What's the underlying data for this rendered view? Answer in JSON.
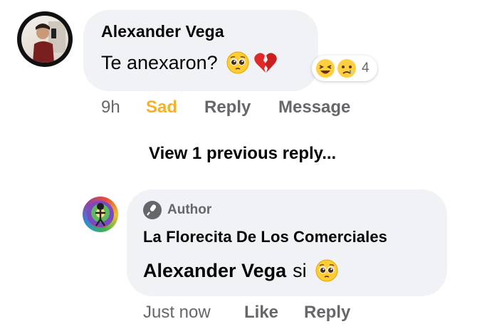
{
  "comment": {
    "author": "Alexander Vega",
    "text": "Te anexaron?",
    "emojis": [
      "pleading-face",
      "broken-heart"
    ],
    "reactions": {
      "icons": [
        "laughing-face",
        "crying-face"
      ],
      "count": "4"
    },
    "actions": {
      "time": "9h",
      "reaction_label": "Sad",
      "reply": "Reply",
      "message": "Message"
    }
  },
  "view_previous": "View 1 previous reply...",
  "reply": {
    "badge": "Author",
    "author": "La Florecita De Los Comerciales",
    "mention": "Alexander Vega",
    "text": "si",
    "emoji": "pleading-face",
    "actions": {
      "time": "Just now",
      "like": "Like",
      "reply": "Reply"
    }
  },
  "colors": {
    "bubble": "#f0f2f5",
    "secondary_text": "#65676b",
    "sad_reaction": "#f7b125"
  }
}
